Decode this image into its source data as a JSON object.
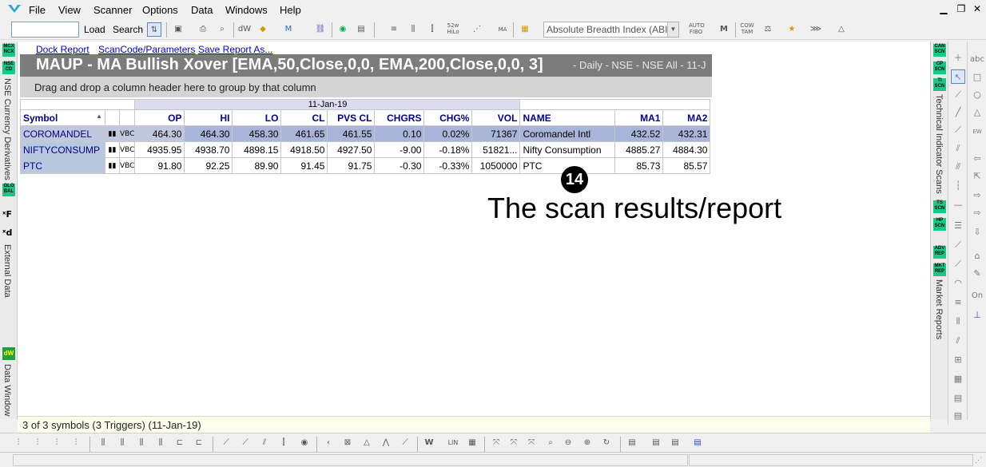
{
  "menu": {
    "items": [
      "File",
      "View",
      "Scanner",
      "Options",
      "Data",
      "Windows",
      "Help"
    ]
  },
  "toolbar": {
    "load_label": "Load",
    "search_label": "Search",
    "indicator_combo": "Absolute Breadth Index (ABI"
  },
  "left_panel": {
    "badges": [
      "MCX\nNCX",
      "NSE\nCD",
      "GLO\nBAL"
    ],
    "currency_label": "NSE Currency Derivatives",
    "external_label": "External Data",
    "data_window_label": "Data Window"
  },
  "report": {
    "dock_link": "Dock Report",
    "scancode_link": "ScanCode/Parameters",
    "save_link": "Save Report As...",
    "title": "MAUP - MA Bullish Xover [EMA,50,Close,0,0, EMA,200,Close,0,0, 3]",
    "subtitle": "- Daily - NSE - NSE All - 11-J",
    "group_hint": "Drag and drop a column header here to group by that column",
    "date_header": "11-Jan-19",
    "columns": [
      "Symbol",
      "OP",
      "HI",
      "LO",
      "CL",
      "PVS CL",
      "CHGRS",
      "CHG%",
      "VOL",
      "NAME",
      "MA1",
      "MA2"
    ],
    "rows": [
      {
        "symbol": "COROMANDEL",
        "op": "464.30",
        "hi": "464.30",
        "lo": "458.30",
        "cl": "461.65",
        "pvs": "461.55",
        "chgrs": "0.10",
        "chgp": "0.02%",
        "vol": "71367",
        "name": "Coromandel Intl",
        "ma1": "432.52",
        "ma2": "432.31"
      },
      {
        "symbol": "NIFTYCONSUMP",
        "op": "4935.95",
        "hi": "4938.70",
        "lo": "4898.15",
        "cl": "4918.50",
        "pvs": "4927.50",
        "chgrs": "-9.00",
        "chgp": "-0.18%",
        "vol": "51821...",
        "name": "Nifty Consumption",
        "ma1": "4885.27",
        "ma2": "4884.30"
      },
      {
        "symbol": "PTC",
        "op": "91.80",
        "hi": "92.25",
        "lo": "89.90",
        "cl": "91.45",
        "pvs": "91.75",
        "chgrs": "-0.30",
        "chgp": "-0.33%",
        "vol": "1050000",
        "name": "PTC",
        "ma1": "85.73",
        "ma2": "85.57"
      }
    ],
    "status": "3 of 3 symbols (3 Triggers) (11-Jan-19)"
  },
  "annotation": {
    "number": "14",
    "text": "The scan results/report"
  },
  "right_panel": {
    "badges": [
      "CAN\nSCN",
      "CP\nSCN",
      "TI\nSCN",
      "TS\nSCN",
      "HP\nSCN",
      "ADV\nREP",
      "MKT\nREP"
    ],
    "tech_label": "Technical Indicator Scans",
    "market_label": "Market Reports"
  },
  "drawbar": {
    "abc_label": "abc",
    "on_label": "On"
  },
  "colors": {
    "accent_badge": "#18c888",
    "title_bg": "#7c7c7c",
    "link": "#0000cc"
  }
}
